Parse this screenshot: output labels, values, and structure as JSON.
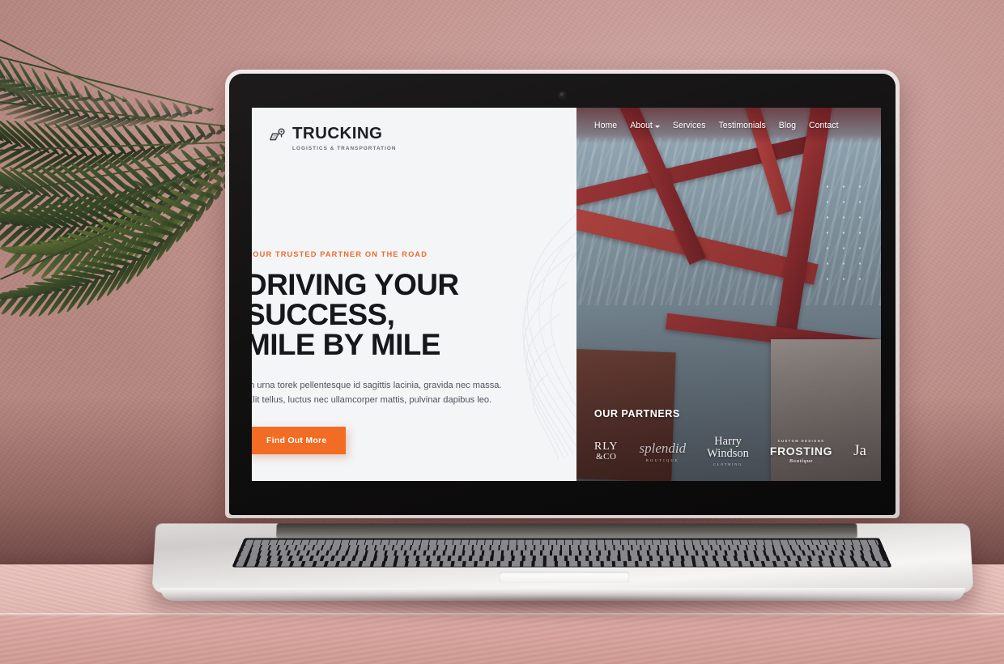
{
  "scene": {
    "description": "Laptop mockup on pink table with palm plant",
    "wall_color": "#c3948f",
    "table_color": "#e4bcb6"
  },
  "site": {
    "brand": {
      "icon": "truck-route-pin-icon",
      "name": "TRUCKING",
      "tagline": "LOGISTICS & TRANSPORTATION"
    },
    "nav": {
      "items": [
        {
          "label": "Home",
          "has_caret": false
        },
        {
          "label": "About",
          "has_caret": true
        },
        {
          "label": "Services",
          "has_caret": false
        },
        {
          "label": "Testimonials",
          "has_caret": false
        },
        {
          "label": "Blog",
          "has_caret": false
        },
        {
          "label": "Contact",
          "has_caret": false
        }
      ]
    },
    "hero": {
      "eyebrow": "YOUR TRUSTED PARTNER ON THE ROAD",
      "headline": "DRIVING YOUR SUCCESS,\nMILE BY MILE",
      "copy": "In urna torek pellentesque id sagittis lacinia, gravida nec massa. Elit tellus, luctus nec ullamcorper mattis, pulvinar dapibus leo.",
      "cta_label": "Find Out More",
      "accent_color": "#f26c23",
      "eyebrow_color": "#ef6a2e"
    },
    "partners": {
      "title": "OUR PARTNERS",
      "logos": [
        {
          "name": "rly-and-co",
          "line1": "RLY",
          "line2": "&CO"
        },
        {
          "name": "splendid-boutique",
          "line1": "splendid",
          "line2": "BOUTIQUE"
        },
        {
          "name": "harry-windson",
          "line1": "Harry",
          "line2": "Windson",
          "line3": "CLOTHING"
        },
        {
          "name": "frosting-boutique",
          "line1": "CUSTOM DESIGNS",
          "line2": "FROSTING",
          "line3": "Boutique"
        },
        {
          "name": "ja-logo",
          "line1": "Ja"
        }
      ]
    },
    "photo": {
      "subject": "red steel gantry crane against blue sky",
      "overlay": "white dot grid"
    }
  }
}
